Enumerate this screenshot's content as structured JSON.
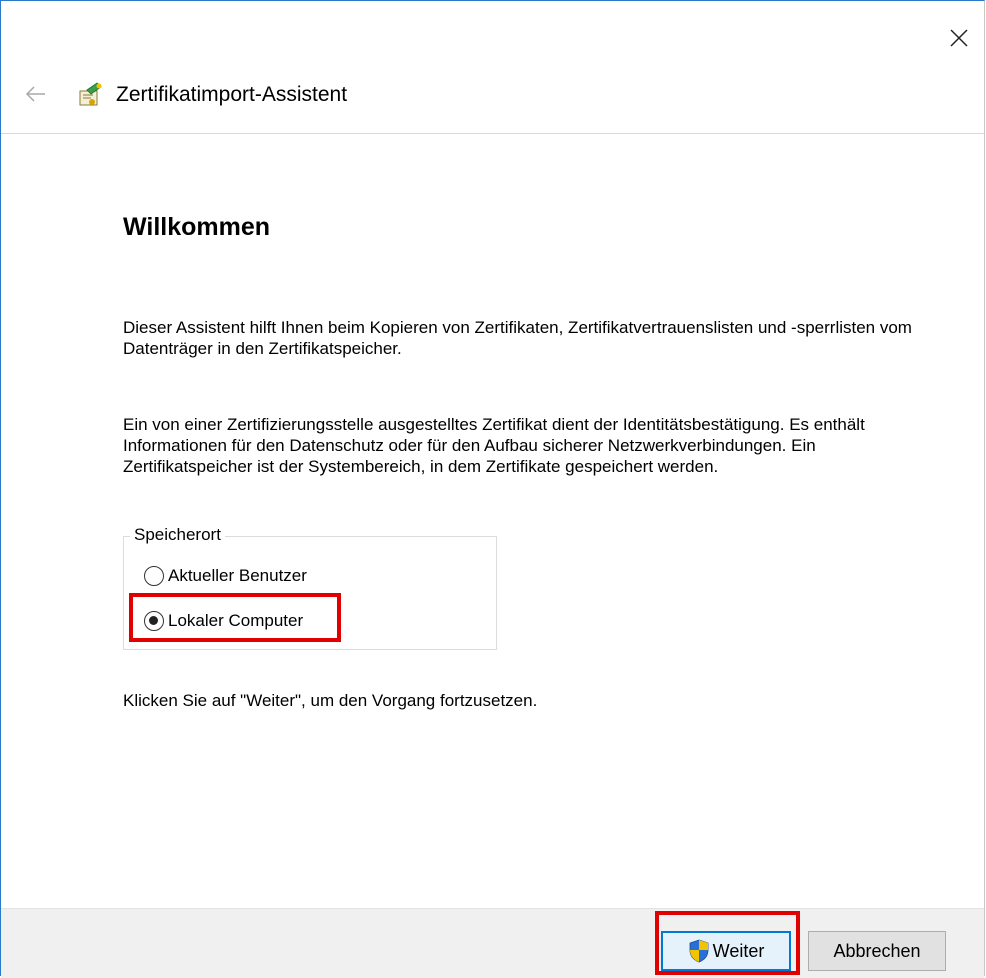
{
  "window": {
    "title": "Zertifikatimport-Assistent",
    "close_icon": "close-icon",
    "back_icon": "back-arrow-icon",
    "app_icon": "certificate-wizard-icon"
  },
  "main": {
    "heading": "Willkommen",
    "paragraph1": "Dieser Assistent hilft Ihnen beim Kopieren von Zertifikaten, Zertifikatvertrauenslisten und -sperrlisten vom Datenträger in den Zertifikatspeicher.",
    "paragraph2": "Ein von einer Zertifizierungsstelle ausgestelltes Zertifikat dient der Identitätsbestätigung. Es enthält Informationen für den Datenschutz oder für den Aufbau sicherer Netzwerkverbindungen. Ein Zertifikatspeicher ist der Systembereich, in dem Zertifikate gespeichert werden.",
    "store_location": {
      "legend": "Speicherort",
      "options": [
        {
          "label": "Aktueller Benutzer",
          "checked": false
        },
        {
          "label": "Lokaler Computer",
          "checked": true
        }
      ]
    },
    "hint": "Klicken Sie auf \"Weiter\", um den Vorgang fortzusetzen."
  },
  "footer": {
    "next_label": "Weiter",
    "next_icon": "uac-shield-icon",
    "cancel_label": "Abbrechen"
  },
  "colors": {
    "accent": "#0078d7",
    "highlight": "#e00000",
    "footer_bg": "#f0f0f0"
  }
}
